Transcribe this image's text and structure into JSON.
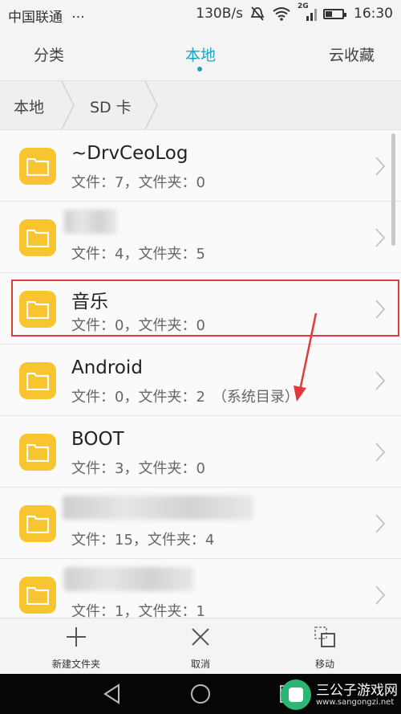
{
  "status_bar": {
    "carrier": "中国联通",
    "more": "···",
    "speed": "130B/s",
    "network": "2G",
    "time": "16:30"
  },
  "tabs": [
    {
      "label": "分类",
      "active": false
    },
    {
      "label": "本地",
      "active": true
    },
    {
      "label": "云收藏",
      "active": false
    }
  ],
  "breadcrumb": [
    "本地",
    "SD 卡"
  ],
  "files": [
    {
      "name": "~DrvCeoLog",
      "meta": "文件：7，文件夹：0",
      "name_hidden": false
    },
    {
      "name": "",
      "meta": "文件：4，文件夹：5",
      "name_hidden": true
    },
    {
      "name": "音乐",
      "meta": "文件：0，文件夹：0",
      "name_hidden": false,
      "highlighted": true
    },
    {
      "name": "Android",
      "meta": "文件：0，文件夹：2　（系统目录）",
      "name_hidden": false
    },
    {
      "name": "BOOT",
      "meta": "文件：3，文件夹：0",
      "name_hidden": false
    },
    {
      "name": "",
      "meta": "文件：15，文件夹：4",
      "name_hidden": true
    },
    {
      "name": "",
      "meta": "文件：1，文件夹：1",
      "name_hidden": true
    }
  ],
  "actions": {
    "new_folder": "新建文件夹",
    "cancel": "取消",
    "move": "移动"
  },
  "watermark": {
    "title": "三公子游戏网",
    "url": "www.sangongzi.net"
  },
  "colors": {
    "accent": "#1aa3c6",
    "folder": "#f8c531",
    "highlight": "#e03a3a"
  }
}
